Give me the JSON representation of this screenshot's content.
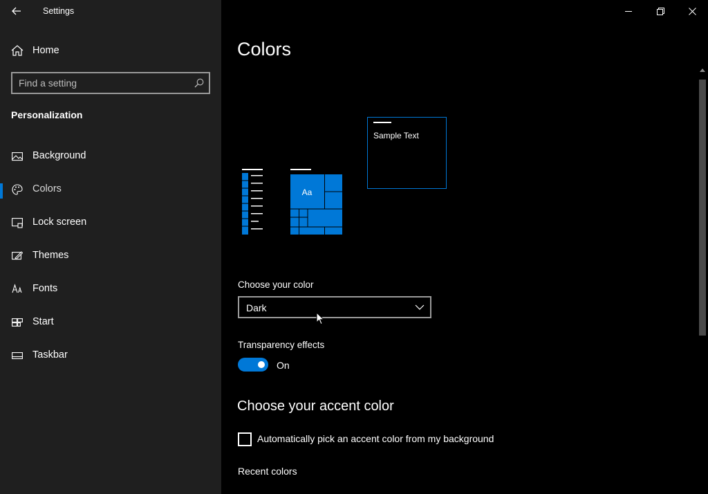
{
  "window": {
    "title": "Settings"
  },
  "sidebar": {
    "home_label": "Home",
    "search_placeholder": "Find a setting",
    "section_title": "Personalization",
    "items": [
      {
        "label": "Background",
        "icon": "picture-icon",
        "active": false
      },
      {
        "label": "Colors",
        "icon": "palette-icon",
        "active": true
      },
      {
        "label": "Lock screen",
        "icon": "lock-screen-icon",
        "active": false
      },
      {
        "label": "Themes",
        "icon": "themes-icon",
        "active": false
      },
      {
        "label": "Fonts",
        "icon": "fonts-icon",
        "active": false
      },
      {
        "label": "Start",
        "icon": "start-icon",
        "active": false
      },
      {
        "label": "Taskbar",
        "icon": "taskbar-icon",
        "active": false
      }
    ]
  },
  "main": {
    "title": "Colors",
    "preview": {
      "sample_text": "Sample Text",
      "tile_text": "Aa"
    },
    "choose_color": {
      "label": "Choose your color",
      "value": "Dark"
    },
    "transparency": {
      "label": "Transparency effects",
      "state": "On"
    },
    "accent_heading": "Choose your accent color",
    "auto_pick_label": "Automatically pick an accent color from my background",
    "recent_colors_label": "Recent colors"
  },
  "colors": {
    "accent": "#0078d7",
    "sidebar_bg": "#1f1f1f",
    "main_bg": "#000000"
  }
}
